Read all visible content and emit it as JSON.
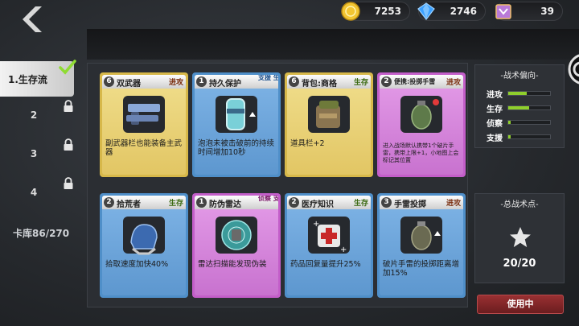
{
  "currency": {
    "gold": "7253",
    "diamond": "2746",
    "ticket": "39"
  },
  "tabs": [
    {
      "label": "1.生存流",
      "active": true
    },
    {
      "label": "2",
      "locked": true
    },
    {
      "label": "3",
      "locked": true
    },
    {
      "label": "4",
      "locked": true
    }
  ],
  "storage_label": "卡库86/270",
  "cards": [
    {
      "num": "6",
      "title": "双武器",
      "tag": "进攻",
      "desc": "副武器栏也能装备主武器",
      "icon": "dual-pistol-icon"
    },
    {
      "num": "1",
      "title": "持久保护",
      "tag": "支援 生存",
      "desc": "泡泡未被击破前的持续时间增加10秒",
      "icon": "shield-canister-icon"
    },
    {
      "num": "6",
      "title": "背包:商格",
      "tag": "生存",
      "desc": "道具栏+2",
      "icon": "backpack-icon"
    },
    {
      "num": "2",
      "title": "便携:投掷手雷",
      "tag": "进攻",
      "desc": "进入战场默认携带1个破片手雷，携带上限+1，小地图上会标记其位置",
      "icon": "grenade-icon"
    },
    {
      "num": "2",
      "title": "拾荒者",
      "tag": "生存",
      "desc": "拾取速度加快40%",
      "icon": "scavenger-glove-icon"
    },
    {
      "num": "1",
      "title": "防伪雷达",
      "tag": "侦察 支援",
      "desc": "雷达扫描能发现伪装",
      "icon": "radar-icon"
    },
    {
      "num": "2",
      "title": "医疗知识",
      "tag": "生存",
      "desc": "药品回复量提升25%",
      "icon": "medkit-icon"
    },
    {
      "num": "3",
      "title": "手雷投掷",
      "tag": "进攻",
      "desc": "破片手雷的投掷距离增加15%",
      "icon": "grenade-throw-icon"
    }
  ],
  "tendency": {
    "title": "-战术偏向-",
    "stats": [
      {
        "label": "进攻",
        "value": 0.45
      },
      {
        "label": "生存",
        "value": 0.5
      },
      {
        "label": "侦察",
        "value": 0.06
      },
      {
        "label": "支援",
        "value": 0.06
      }
    ]
  },
  "points": {
    "title": "-总战术点-",
    "value": "20/20"
  },
  "use_button": "使用中",
  "colors": {
    "gold_card": "#d7b84a",
    "blue_card": "#4f8fc9",
    "purple_card": "#c35ec9",
    "attack_tag": "#7a2e0f",
    "survival_tag": "#3b6a12",
    "support_tag": "#1c4f8a",
    "recon_tag": "#7a1468"
  }
}
